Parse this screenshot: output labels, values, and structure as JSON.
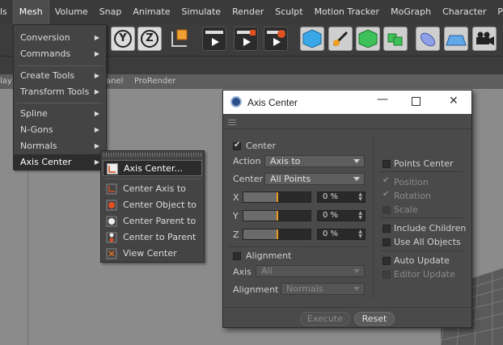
{
  "menubar": [
    "ls",
    "Mesh",
    "Volume",
    "Snap",
    "Animate",
    "Simulate",
    "Render",
    "Sculpt",
    "Motion Tracker",
    "MoGraph",
    "Character",
    "Pipelin"
  ],
  "toolbar": {
    "axis_buttons": [
      "Y",
      "Z"
    ]
  },
  "subbar": {
    "left": "lay",
    "mid": "anel",
    "right": "ProRender"
  },
  "mesh_menu": {
    "items": [
      "Conversion",
      "Commands",
      "Create Tools",
      "Transform Tools",
      "Spline",
      "N-Gons",
      "Normals",
      "Axis Center"
    ],
    "arrow": "▶"
  },
  "submenu": {
    "items": [
      "Axis Center...",
      "Center Axis to",
      "Center Object to",
      "Center Parent to",
      "Center to Parent",
      "View Center"
    ]
  },
  "dialog": {
    "title": "Axis Center",
    "center_label": "Center",
    "action_label": "Action",
    "action_value": "Axis to",
    "center_select_label": "Center",
    "center_select_value": "All Points",
    "axes": [
      {
        "label": "X",
        "value": "0 %",
        "level": 0.5
      },
      {
        "label": "Y",
        "value": "0 %",
        "level": 0.5
      },
      {
        "label": "Z",
        "value": "0 %",
        "level": 0.5
      }
    ],
    "alignment_check_label": "Alignment",
    "axis_label": "Axis",
    "axis_value": "All",
    "alignment_label": "Alignment",
    "alignment_value": "Normals",
    "right": {
      "points_center": "Points Center",
      "position": "Position",
      "rotation": "Rotation",
      "scale": "Scale",
      "include_children": "Include Children",
      "use_all_objects": "Use All Objects",
      "auto_update": "Auto Update",
      "editor_update": "Editor Update"
    },
    "execute": "Execute",
    "reset": "Reset"
  },
  "colors": {
    "accent": "#e89a1a",
    "menu_bg": "#444444",
    "dialog_bg": "#4a4a4a"
  }
}
